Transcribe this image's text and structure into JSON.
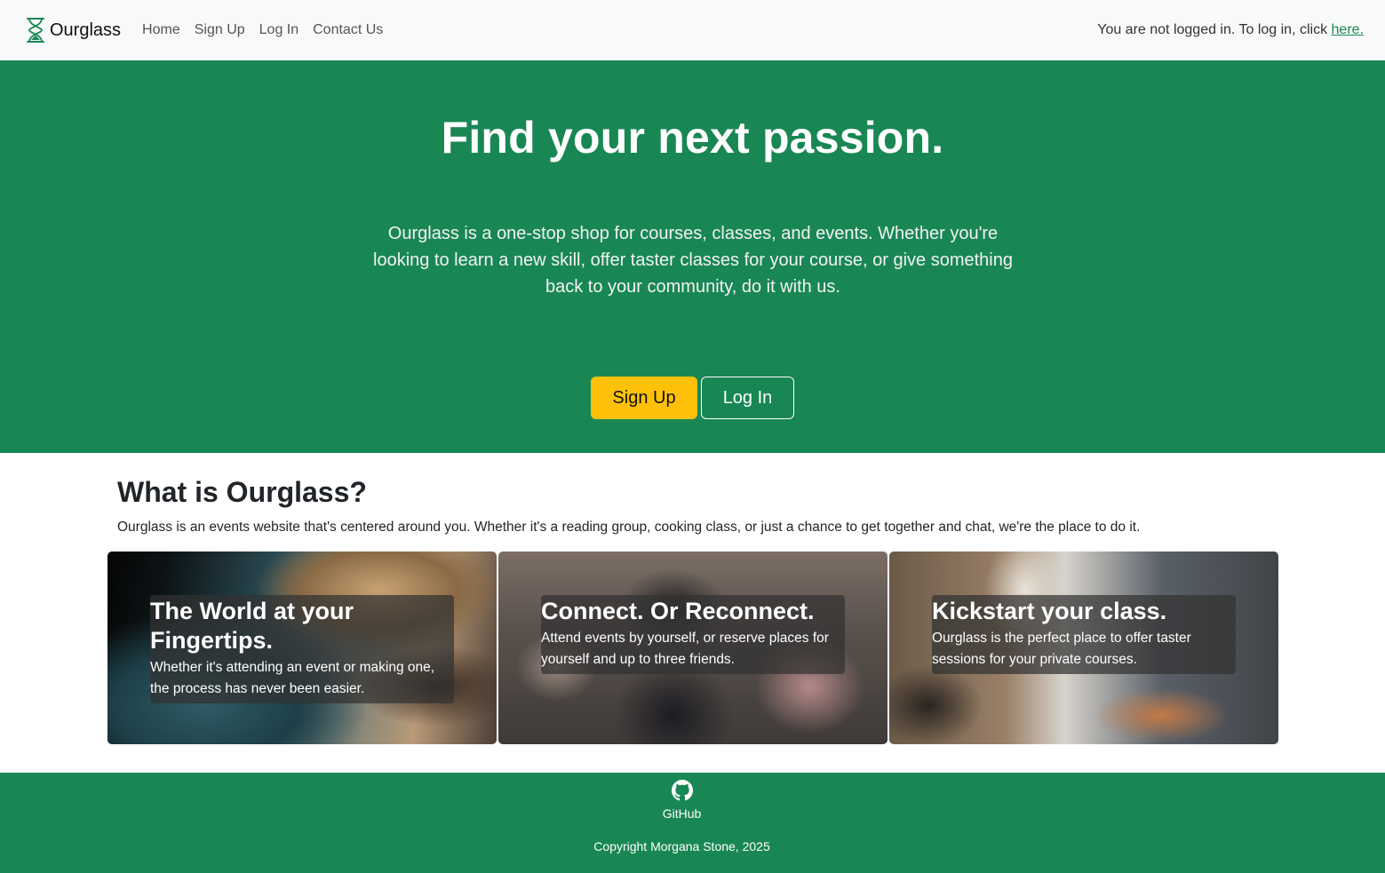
{
  "nav": {
    "brand": "Ourglass",
    "links": [
      "Home",
      "Sign Up",
      "Log In",
      "Contact Us"
    ],
    "status_text": "You are not logged in. To log in, click ",
    "status_link": "here."
  },
  "hero": {
    "title": "Find your next passion.",
    "description": "Ourglass is a one-stop shop for courses, classes, and events. Whether you're looking to learn a new skill, offer taster classes for your course, or give something back to your community, do it with us.",
    "signup_label": "Sign Up",
    "login_label": "Log In"
  },
  "about": {
    "heading": "What is Ourglass?",
    "text": "Ourglass is an events website that's centered around you. Whether it's a reading group, cooking class, or just a chance to get together and chat, we're the place to do it."
  },
  "cards": [
    {
      "title": "The World at your Fingertips.",
      "text": "Whether it's attending an event or making one, the process has never been easier."
    },
    {
      "title": "Connect. Or Reconnect.",
      "text": "Attend events by yourself, or reserve places for yourself and up to three friends."
    },
    {
      "title": "Kickstart your class.",
      "text": "Ourglass is the perfect place to offer taster sessions for your private courses."
    }
  ],
  "footer": {
    "github_label": "GitHub",
    "copyright": "Copyright Morgana Stone, 2025"
  },
  "colors": {
    "primary_green": "#198754",
    "accent_yellow": "#ffc107",
    "nav_bg": "#f8f9fa"
  }
}
